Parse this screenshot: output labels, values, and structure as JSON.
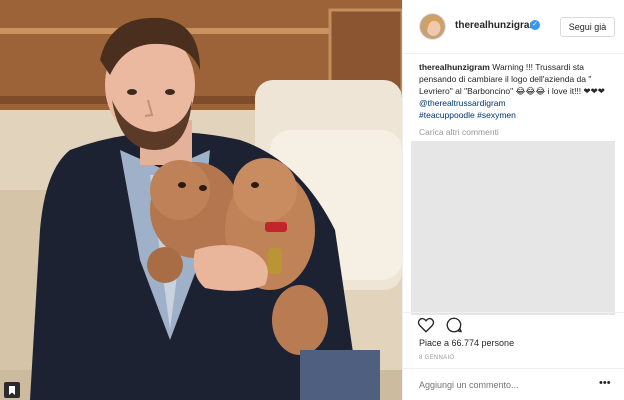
{
  "post": {
    "username": "therealhunzigram",
    "follow_label": "Segui già",
    "caption_user": "therealhunzigram",
    "caption_text": "Warning !!! Trussardi sta pensando di cambiare il logo dell'azienda da \" Levriero\" al \"Barboncino\" 😂😂😂 i love it!!! ❤❤❤",
    "caption_mention": "@therealtrussardigram",
    "caption_hashtags": "#teacuppoodle #sexymen",
    "load_more_label": "Carica altri commenti",
    "likes_label": "Piace a 66.774 persone",
    "date_label": "8 GENNAIO",
    "comment_placeholder": "Aggiungi un commento...",
    "more_label": "•••"
  },
  "icons": {
    "like": "heart-outline-icon",
    "comment": "speech-bubble-icon",
    "verified": "verified-badge-icon",
    "more": "more-dots-icon",
    "corner": "bookmark-icon"
  },
  "colors": {
    "link": "#003569",
    "verified": "#3897f0",
    "muted": "#999999",
    "text": "#262626"
  }
}
